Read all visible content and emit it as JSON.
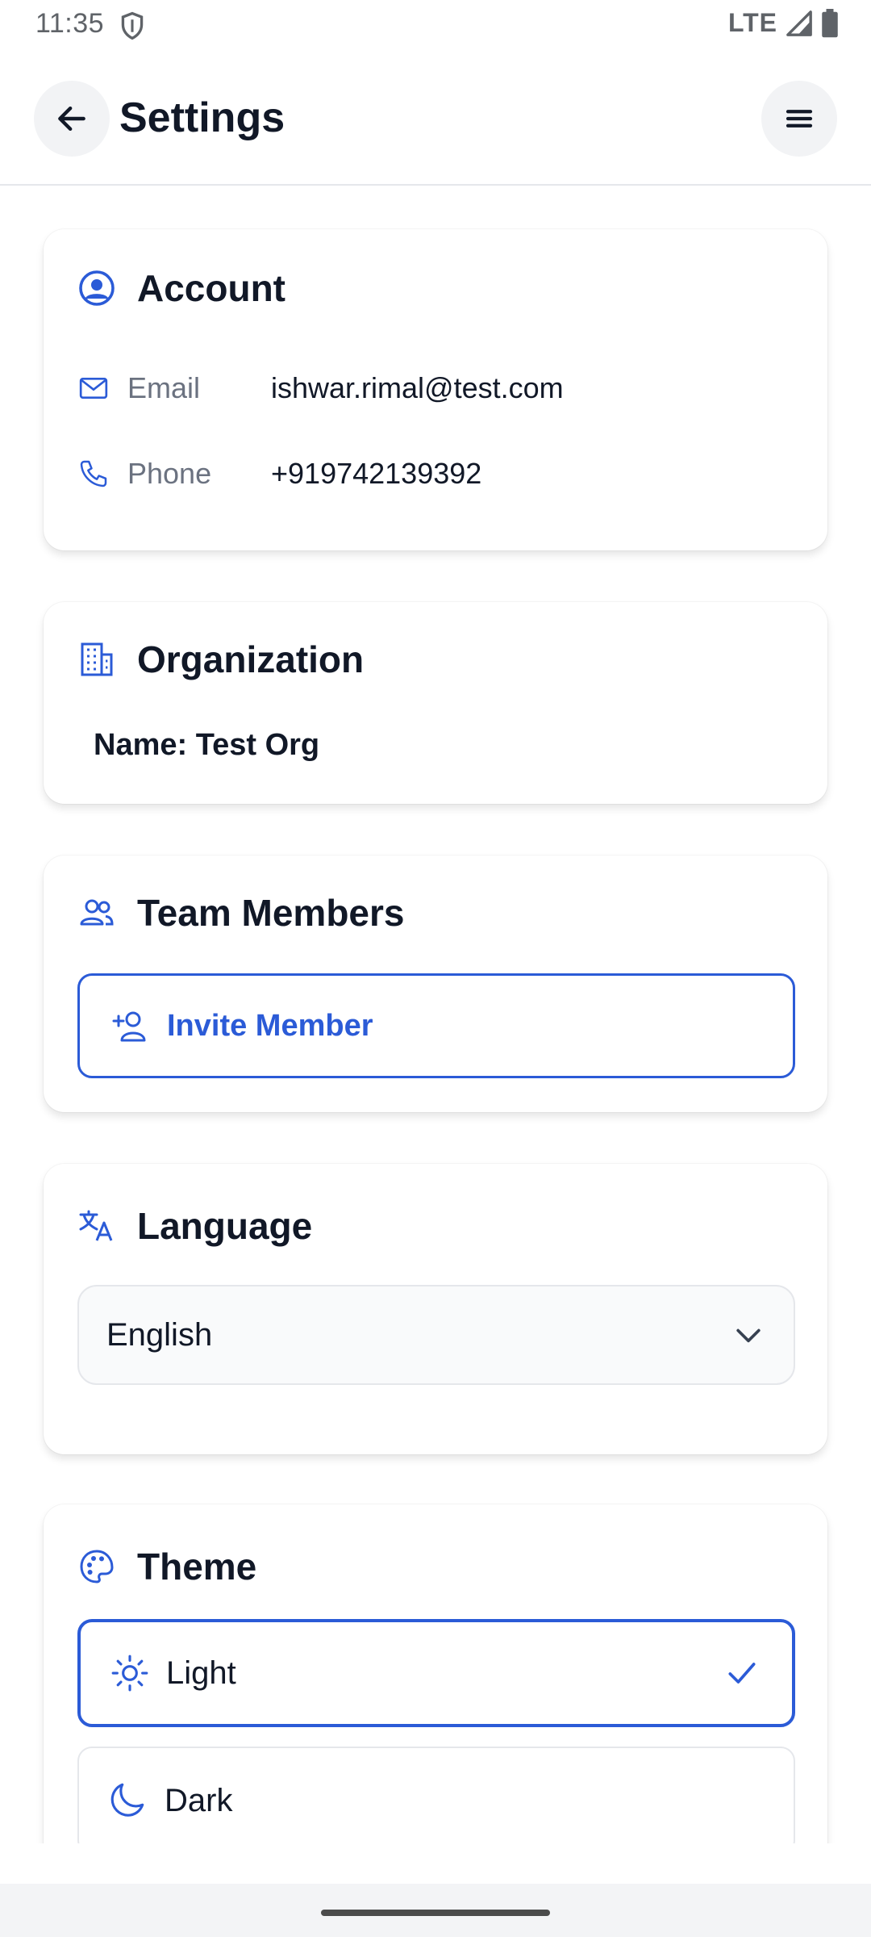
{
  "status_bar": {
    "time": "11:35",
    "network": "LTE"
  },
  "app_bar": {
    "title": "Settings"
  },
  "account": {
    "title": "Account",
    "email_label": "Email",
    "email_value": "ishwar.rimal@test.com",
    "phone_label": "Phone",
    "phone_value": "+919742139392"
  },
  "organization": {
    "title": "Organization",
    "name": "Name: Test Org"
  },
  "team": {
    "title": "Team Members",
    "invite_label": "Invite Member"
  },
  "language": {
    "title": "Language",
    "selected": "English"
  },
  "theme": {
    "title": "Theme",
    "options": [
      {
        "label": "Light",
        "selected": true
      },
      {
        "label": "Dark",
        "selected": false
      }
    ]
  },
  "colors": {
    "accent": "#2b5bd7",
    "text": "#111827",
    "muted": "#6b7280"
  }
}
